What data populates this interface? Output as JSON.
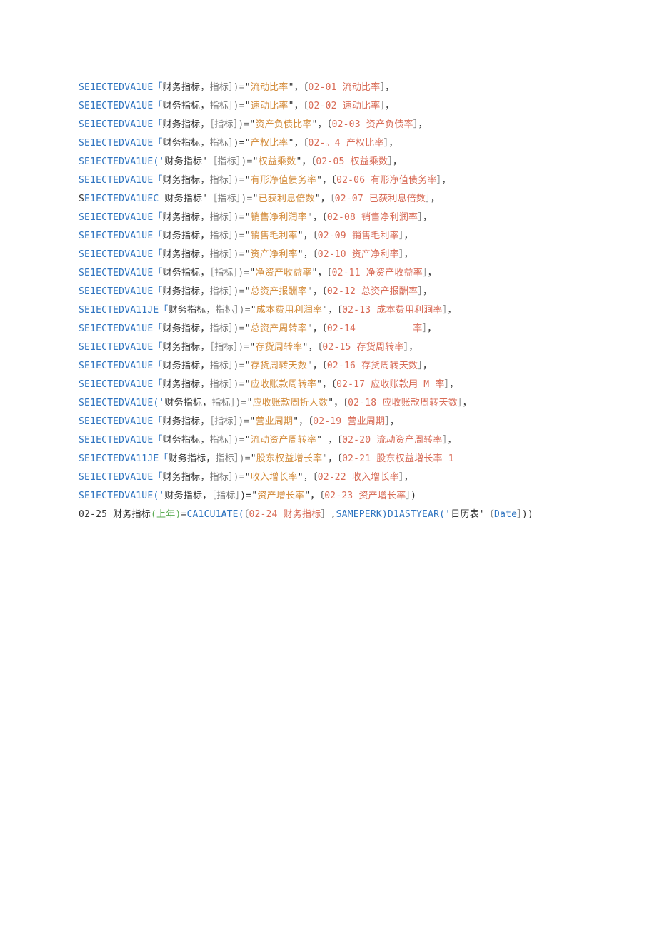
{
  "lines": [
    {
      "segments": [
        {
          "cls": "c-blue",
          "text": "SE1ECTEDVA1UE「"
        },
        {
          "cls": "c-text",
          "text": "财务指标，"
        },
        {
          "cls": "c-gray",
          "text": "指标］)="
        },
        {
          "cls": "c-text",
          "text": "\""
        },
        {
          "cls": "c-orange",
          "text": "流动比率"
        },
        {
          "cls": "c-text",
          "text": "\"，〔"
        },
        {
          "cls": "c-red",
          "text": "02-01 流动比率"
        },
        {
          "cls": "c-gray",
          "text": "］"
        },
        {
          "cls": "c-text",
          "text": "，"
        }
      ]
    },
    {
      "segments": [
        {
          "cls": "c-blue",
          "text": "SE1ECTEDVA1UE「"
        },
        {
          "cls": "c-text",
          "text": "财务指标，"
        },
        {
          "cls": "c-gray",
          "text": "指标］)="
        },
        {
          "cls": "c-text",
          "text": "\""
        },
        {
          "cls": "c-orange",
          "text": "速动比率"
        },
        {
          "cls": "c-text",
          "text": "\"，〔"
        },
        {
          "cls": "c-red",
          "text": "02-02 速动比率"
        },
        {
          "cls": "c-gray",
          "text": "］"
        },
        {
          "cls": "c-text",
          "text": "，"
        }
      ]
    },
    {
      "segments": [
        {
          "cls": "c-blue",
          "text": "SE1ECTEDVA1UE「"
        },
        {
          "cls": "c-text",
          "text": "财务指标，"
        },
        {
          "cls": "c-gray",
          "text": "［指标］)="
        },
        {
          "cls": "c-text",
          "text": "\""
        },
        {
          "cls": "c-orange",
          "text": "资产负债比率"
        },
        {
          "cls": "c-text",
          "text": "\"，〔"
        },
        {
          "cls": "c-red",
          "text": "02-03 资产负债率"
        },
        {
          "cls": "c-gray",
          "text": "］"
        },
        {
          "cls": "c-text",
          "text": "，"
        }
      ]
    },
    {
      "segments": [
        {
          "cls": "c-blue",
          "text": "SE1ECTEDVA1UE「"
        },
        {
          "cls": "c-text",
          "text": "财务指标，"
        },
        {
          "cls": "c-gray",
          "text": "指标］"
        },
        {
          "cls": "c-text",
          "text": ")=\""
        },
        {
          "cls": "c-orange",
          "text": "产权比率"
        },
        {
          "cls": "c-text",
          "text": "\"，〔"
        },
        {
          "cls": "c-red",
          "text": "02-。4 产权比率"
        },
        {
          "cls": "c-gray",
          "text": "］"
        },
        {
          "cls": "c-text",
          "text": "，"
        }
      ]
    },
    {
      "segments": [
        {
          "cls": "c-blue",
          "text": "SE1ECTEDVA1UE('"
        },
        {
          "cls": "c-text",
          "text": "财务指标'"
        },
        {
          "cls": "c-gray",
          "text": "［指标］)="
        },
        {
          "cls": "c-text",
          "text": "\""
        },
        {
          "cls": "c-orange",
          "text": "权益乘数"
        },
        {
          "cls": "c-text",
          "text": "\"，〔"
        },
        {
          "cls": "c-red",
          "text": "02-05 权益乘数"
        },
        {
          "cls": "c-gray",
          "text": "］"
        },
        {
          "cls": "c-text",
          "text": "，"
        }
      ]
    },
    {
      "segments": [
        {
          "cls": "c-blue",
          "text": "SE1ECTEDVA1UE「"
        },
        {
          "cls": "c-text",
          "text": "财务指标，"
        },
        {
          "cls": "c-gray",
          "text": "指标］)="
        },
        {
          "cls": "c-text",
          "text": "\""
        },
        {
          "cls": "c-orange",
          "text": "有形净值债务率"
        },
        {
          "cls": "c-text",
          "text": "\"，〔"
        },
        {
          "cls": "c-red",
          "text": "02-06 有形净值债务率"
        },
        {
          "cls": "c-gray",
          "text": "］"
        },
        {
          "cls": "c-text",
          "text": "，"
        }
      ]
    },
    {
      "segments": [
        {
          "cls": "c-text",
          "text": "S"
        },
        {
          "cls": "c-blue",
          "text": "E1ECTEDVA1UEC "
        },
        {
          "cls": "c-text",
          "text": "财务指标'"
        },
        {
          "cls": "c-gray",
          "text": "［指标］)="
        },
        {
          "cls": "c-text",
          "text": "\""
        },
        {
          "cls": "c-orange",
          "text": "已获利息倍数"
        },
        {
          "cls": "c-text",
          "text": "\"，"
        },
        {
          "cls": "c-gray",
          "text": "〔"
        },
        {
          "cls": "c-red",
          "text": "02-07 已获利息倍数"
        },
        {
          "cls": "c-gray",
          "text": "］"
        },
        {
          "cls": "c-text",
          "text": "，"
        }
      ]
    },
    {
      "segments": [
        {
          "cls": "c-blue",
          "text": "SE1ECTEDVA1UE「"
        },
        {
          "cls": "c-text",
          "text": "财务指标，"
        },
        {
          "cls": "c-gray",
          "text": "指标］)="
        },
        {
          "cls": "c-text",
          "text": "\""
        },
        {
          "cls": "c-orange",
          "text": "销售净利润率"
        },
        {
          "cls": "c-text",
          "text": "\"，〔"
        },
        {
          "cls": "c-red",
          "text": "02-08 销售净利润率"
        },
        {
          "cls": "c-gray",
          "text": "］"
        },
        {
          "cls": "c-text",
          "text": "，"
        }
      ]
    },
    {
      "segments": [
        {
          "cls": "c-blue",
          "text": "SE1ECTEDVA1UE「"
        },
        {
          "cls": "c-text",
          "text": "财务指标，"
        },
        {
          "cls": "c-gray",
          "text": "指标］)="
        },
        {
          "cls": "c-text",
          "text": "\""
        },
        {
          "cls": "c-orange",
          "text": "销售毛利率"
        },
        {
          "cls": "c-text",
          "text": "\"，〔"
        },
        {
          "cls": "c-red",
          "text": "02-09 销售毛利率"
        },
        {
          "cls": "c-gray",
          "text": "］"
        },
        {
          "cls": "c-text",
          "text": "，"
        }
      ]
    },
    {
      "segments": [
        {
          "cls": "c-blue",
          "text": "SE1ECTEDVA1UE「"
        },
        {
          "cls": "c-text",
          "text": "财务指标，"
        },
        {
          "cls": "c-gray",
          "text": "指标］)="
        },
        {
          "cls": "c-text",
          "text": "\""
        },
        {
          "cls": "c-orange",
          "text": "资产净利率"
        },
        {
          "cls": "c-text",
          "text": "\"，〔"
        },
        {
          "cls": "c-red",
          "text": "02-10 资产净利率"
        },
        {
          "cls": "c-gray",
          "text": "］"
        },
        {
          "cls": "c-text",
          "text": "，"
        }
      ]
    },
    {
      "segments": [
        {
          "cls": "c-blue",
          "text": "SE1ECTEDVA1UE「"
        },
        {
          "cls": "c-text",
          "text": "财务指标，"
        },
        {
          "cls": "c-gray",
          "text": "［指标］)="
        },
        {
          "cls": "c-text",
          "text": "\""
        },
        {
          "cls": "c-orange",
          "text": "净资产收益率"
        },
        {
          "cls": "c-text",
          "text": "\"，〔"
        },
        {
          "cls": "c-red",
          "text": "02-11 净资产收益率"
        },
        {
          "cls": "c-gray",
          "text": "］"
        },
        {
          "cls": "c-text",
          "text": "，"
        }
      ]
    },
    {
      "segments": [
        {
          "cls": "c-blue",
          "text": "SE1ECTEDVA1UE「"
        },
        {
          "cls": "c-text",
          "text": "财务指标，"
        },
        {
          "cls": "c-gray",
          "text": "指标］)="
        },
        {
          "cls": "c-text",
          "text": "\""
        },
        {
          "cls": "c-orange",
          "text": "总资产报酬率"
        },
        {
          "cls": "c-text",
          "text": "\"，〔"
        },
        {
          "cls": "c-red",
          "text": "02-12 总资产报酬率"
        },
        {
          "cls": "c-gray",
          "text": "］"
        },
        {
          "cls": "c-text",
          "text": "，"
        }
      ]
    },
    {
      "segments": [
        {
          "cls": "c-blue",
          "text": "SE1ECTEDVA11JE「"
        },
        {
          "cls": "c-text",
          "text": "财务指标，"
        },
        {
          "cls": "c-gray",
          "text": "指标］)="
        },
        {
          "cls": "c-text",
          "text": "\""
        },
        {
          "cls": "c-orange",
          "text": "成本费用利润率"
        },
        {
          "cls": "c-text",
          "text": "\"，〔"
        },
        {
          "cls": "c-red",
          "text": "02-13 成本费用利涧率"
        },
        {
          "cls": "c-gray",
          "text": "］"
        },
        {
          "cls": "c-text",
          "text": "，"
        }
      ]
    },
    {
      "segments": [
        {
          "cls": "c-blue",
          "text": "SE1ECTEDVA1UE「"
        },
        {
          "cls": "c-text",
          "text": "财务指标，"
        },
        {
          "cls": "c-gray",
          "text": "指标］)="
        },
        {
          "cls": "c-text",
          "text": "\""
        },
        {
          "cls": "c-orange",
          "text": "总资产周转率"
        },
        {
          "cls": "c-text",
          "text": "\"，〔"
        },
        {
          "cls": "c-red",
          "text": "02-14          率"
        },
        {
          "cls": "c-gray",
          "text": "］"
        },
        {
          "cls": "c-text",
          "text": "，"
        }
      ]
    },
    {
      "segments": [
        {
          "cls": "c-blue",
          "text": "SE1ECTEDVA1UE「"
        },
        {
          "cls": "c-text",
          "text": "财务指标，"
        },
        {
          "cls": "c-gray",
          "text": "［指标］)="
        },
        {
          "cls": "c-text",
          "text": "\""
        },
        {
          "cls": "c-orange",
          "text": "存货周转率"
        },
        {
          "cls": "c-text",
          "text": "\"，〔"
        },
        {
          "cls": "c-red",
          "text": "02-15 存货周转率"
        },
        {
          "cls": "c-gray",
          "text": "］"
        },
        {
          "cls": "c-text",
          "text": "，"
        }
      ]
    },
    {
      "segments": [
        {
          "cls": "c-blue",
          "text": "SE1ECTEDVA1UE「"
        },
        {
          "cls": "c-text",
          "text": "财务指标，"
        },
        {
          "cls": "c-gray",
          "text": "指标］)="
        },
        {
          "cls": "c-text",
          "text": "\""
        },
        {
          "cls": "c-orange",
          "text": "存货周转天数"
        },
        {
          "cls": "c-text",
          "text": "\"，〔"
        },
        {
          "cls": "c-red",
          "text": "02-16 存货周转天数"
        },
        {
          "cls": "c-gray",
          "text": "］"
        },
        {
          "cls": "c-text",
          "text": "，"
        }
      ]
    },
    {
      "segments": [
        {
          "cls": "c-blue",
          "text": "SE1ECTEDVA1UE「"
        },
        {
          "cls": "c-text",
          "text": "财务指标，"
        },
        {
          "cls": "c-gray",
          "text": "指标］)="
        },
        {
          "cls": "c-text",
          "text": "\""
        },
        {
          "cls": "c-orange",
          "text": "应收账款周转率"
        },
        {
          "cls": "c-text",
          "text": "\"，〔"
        },
        {
          "cls": "c-red",
          "text": "02-17 应收账款用 M 率"
        },
        {
          "cls": "c-gray",
          "text": "］"
        },
        {
          "cls": "c-text",
          "text": "，"
        }
      ]
    },
    {
      "segments": [
        {
          "cls": "c-blue",
          "text": "SE1ECTEDVA1UE('"
        },
        {
          "cls": "c-text",
          "text": "财务指标，"
        },
        {
          "cls": "c-gray",
          "text": "指标］)="
        },
        {
          "cls": "c-text",
          "text": "\""
        },
        {
          "cls": "c-orange",
          "text": "应收账款周折人数"
        },
        {
          "cls": "c-text",
          "text": "\"，〔"
        },
        {
          "cls": "c-red",
          "text": "02-18 应收账款周转天数"
        },
        {
          "cls": "c-gray",
          "text": "］"
        },
        {
          "cls": "c-text",
          "text": "，"
        }
      ]
    },
    {
      "segments": [
        {
          "cls": "c-blue",
          "text": "SE1ECTEDVA1UE「"
        },
        {
          "cls": "c-text",
          "text": "财务指标，"
        },
        {
          "cls": "c-gray",
          "text": "［指标］)="
        },
        {
          "cls": "c-text",
          "text": "\""
        },
        {
          "cls": "c-orange",
          "text": "营业周期"
        },
        {
          "cls": "c-text",
          "text": "\"，〔"
        },
        {
          "cls": "c-red",
          "text": "02-19 营业周期"
        },
        {
          "cls": "c-gray",
          "text": "］"
        },
        {
          "cls": "c-text",
          "text": "，"
        }
      ]
    },
    {
      "segments": [
        {
          "cls": "c-blue",
          "text": "SE1ECTEDVA1UE「"
        },
        {
          "cls": "c-text",
          "text": "财务指标，"
        },
        {
          "cls": "c-gray",
          "text": "指标］)="
        },
        {
          "cls": "c-text",
          "text": "\""
        },
        {
          "cls": "c-orange",
          "text": "流动资产周转率"
        },
        {
          "cls": "c-text",
          "text": "\" ，〔"
        },
        {
          "cls": "c-red",
          "text": "02-20 流动资产周转率"
        },
        {
          "cls": "c-gray",
          "text": "］"
        },
        {
          "cls": "c-text",
          "text": "，"
        }
      ]
    },
    {
      "segments": [
        {
          "cls": "c-blue",
          "text": "SE1ECTEDVA11JE「"
        },
        {
          "cls": "c-text",
          "text": "财务指标，"
        },
        {
          "cls": "c-gray",
          "text": "指标］)="
        },
        {
          "cls": "c-text",
          "text": "\""
        },
        {
          "cls": "c-orange",
          "text": "股东权益增长率"
        },
        {
          "cls": "c-text",
          "text": "\"，〔"
        },
        {
          "cls": "c-red",
          "text": "02-21 股东权益增长率 1"
        }
      ]
    },
    {
      "segments": [
        {
          "cls": "c-blue",
          "text": "SE1ECTEDVA1UE「"
        },
        {
          "cls": "c-text",
          "text": "财务指标，"
        },
        {
          "cls": "c-gray",
          "text": "指标］)="
        },
        {
          "cls": "c-text",
          "text": "\""
        },
        {
          "cls": "c-orange",
          "text": "收入增长率"
        },
        {
          "cls": "c-text",
          "text": "\"，〔"
        },
        {
          "cls": "c-red",
          "text": "02-22 收入增长率"
        },
        {
          "cls": "c-gray",
          "text": "］"
        },
        {
          "cls": "c-text",
          "text": "，"
        }
      ]
    },
    {
      "segments": [
        {
          "cls": "c-blue",
          "text": "SE1ECTEDVA1UE('"
        },
        {
          "cls": "c-text",
          "text": "财务指标，"
        },
        {
          "cls": "c-gray",
          "text": "［指标］"
        },
        {
          "cls": "c-text",
          "text": ")=\""
        },
        {
          "cls": "c-orange",
          "text": "资产增长率"
        },
        {
          "cls": "c-text",
          "text": "\"，〔"
        },
        {
          "cls": "c-red",
          "text": "02-23 资产增长率"
        },
        {
          "cls": "c-gray",
          "text": "］"
        },
        {
          "cls": "c-text",
          "text": ")"
        }
      ]
    },
    {
      "segments": [
        {
          "cls": "c-text",
          "text": "02-25 财务指标"
        },
        {
          "cls": "c-green",
          "text": "(上年)"
        },
        {
          "cls": "c-text",
          "text": "="
        },
        {
          "cls": "c-blue",
          "text": "CA1CU1ATE("
        },
        {
          "cls": "c-gray",
          "text": "〔"
        },
        {
          "cls": "c-red",
          "text": "02-24 财务指标"
        },
        {
          "cls": "c-gray",
          "text": "］"
        },
        {
          "cls": "c-text",
          "text": ","
        },
        {
          "cls": "c-blue",
          "text": "SAMEPERK)D1ASTYEAR('"
        },
        {
          "cls": "c-text",
          "text": "日历表'"
        },
        {
          "cls": "c-gray",
          "text": "〔"
        },
        {
          "cls": "c-blue",
          "text": "Date"
        },
        {
          "cls": "c-gray",
          "text": "］"
        },
        {
          "cls": "c-text",
          "text": "))"
        }
      ]
    }
  ]
}
